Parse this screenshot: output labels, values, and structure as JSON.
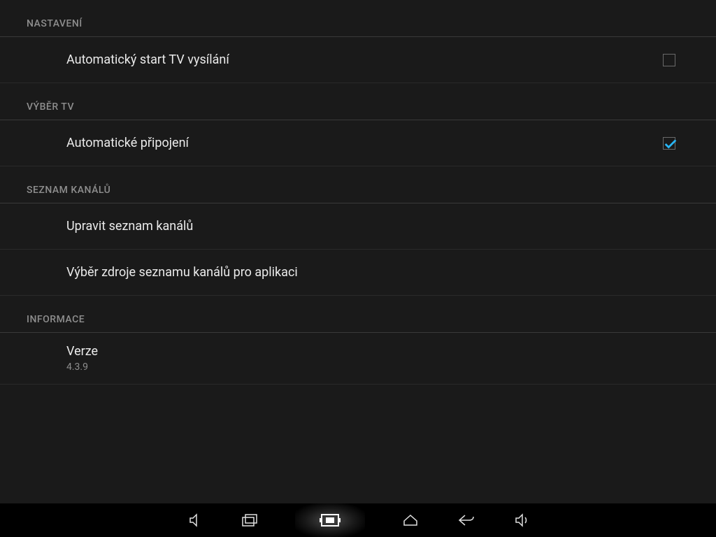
{
  "sections": {
    "settings": {
      "header": "NASTAVENÍ",
      "items": {
        "auto_start": {
          "label": "Automatický start TV vysílání",
          "checked": false
        }
      }
    },
    "tv_select": {
      "header": "VÝBĚR TV",
      "items": {
        "auto_connect": {
          "label": "Automatické připojení",
          "checked": true
        }
      }
    },
    "channel_list": {
      "header": "SEZNAM KANÁLŮ",
      "items": {
        "edit_channels": {
          "label": "Upravit seznam kanálů"
        },
        "select_source": {
          "label": "Výběr zdroje seznamu kanálů pro aplikaci"
        }
      }
    },
    "information": {
      "header": "INFORMACE",
      "items": {
        "version": {
          "label": "Verze",
          "value": "4.3.9"
        }
      }
    }
  }
}
